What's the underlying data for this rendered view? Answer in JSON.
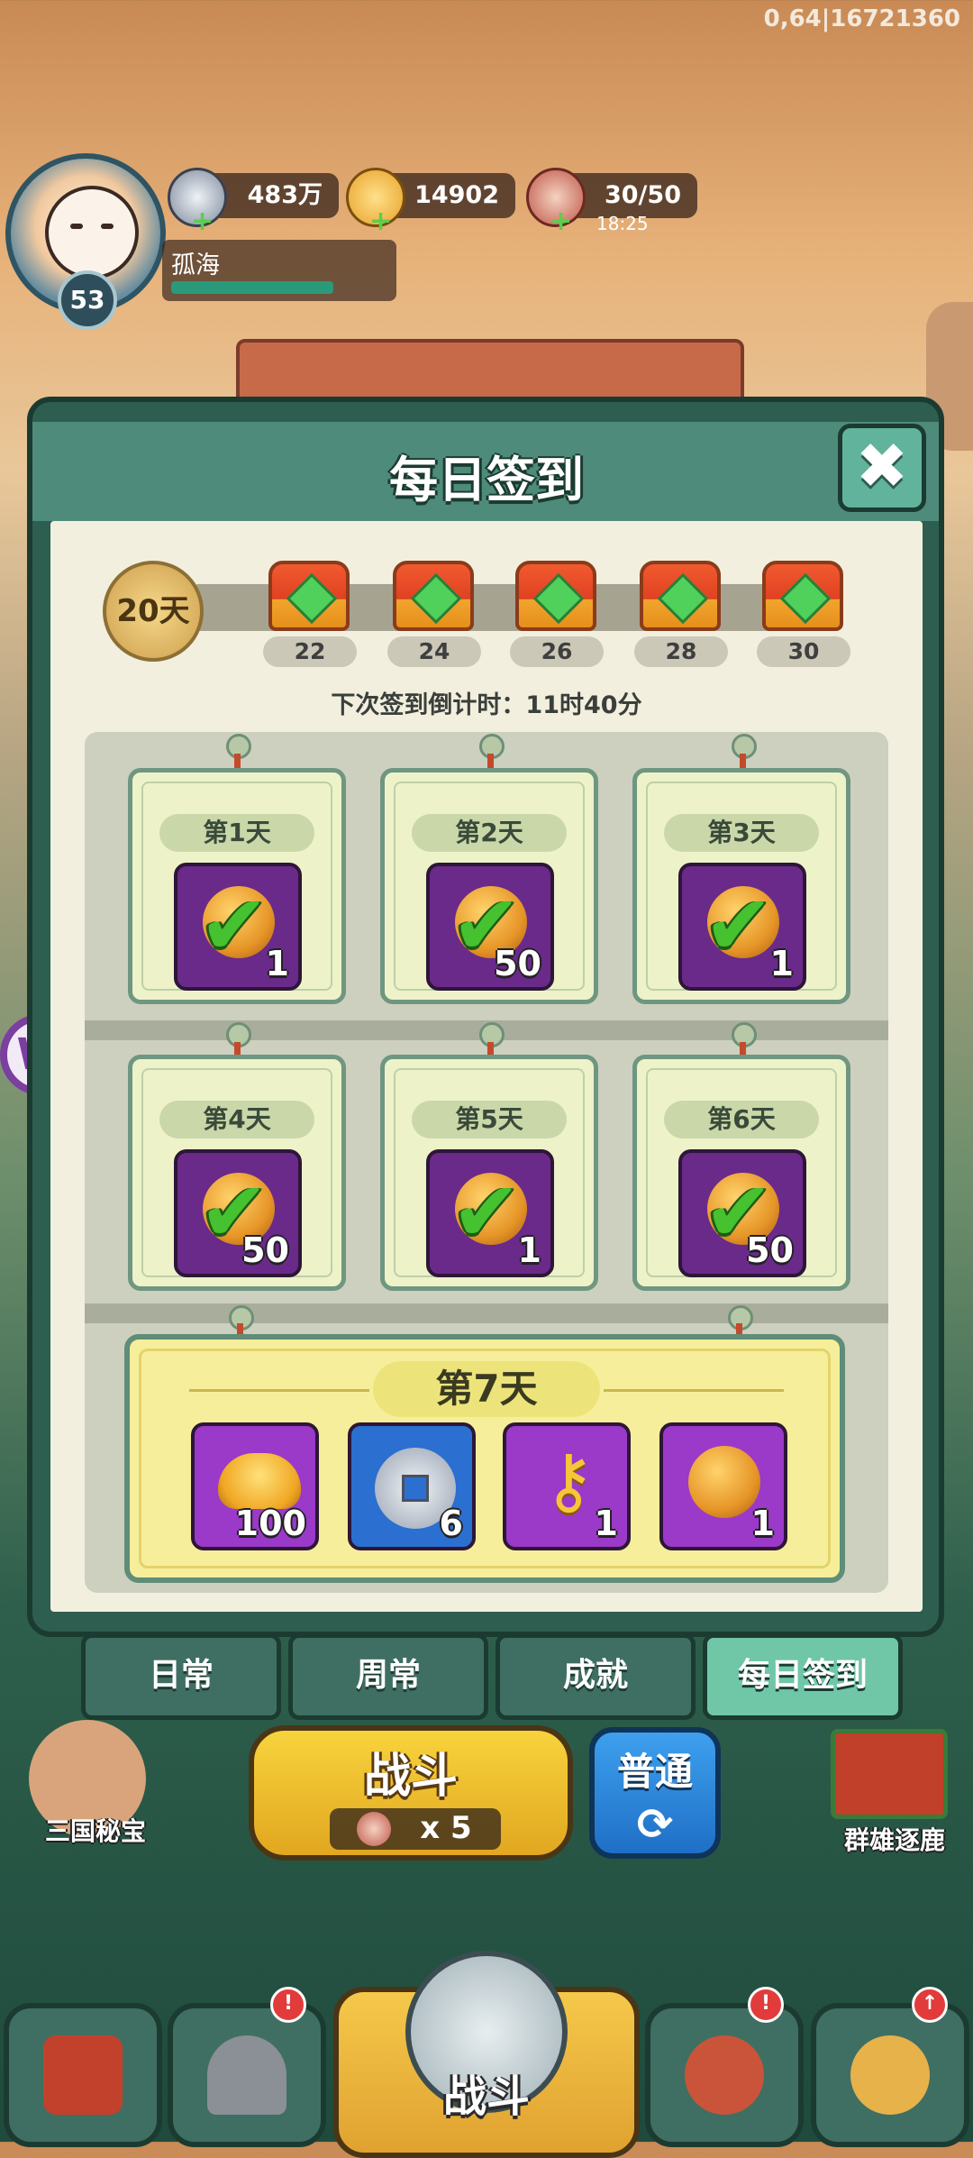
{
  "debug_text": "0,64|16721360",
  "player": {
    "name": "孤海",
    "level": "53"
  },
  "resources": {
    "silver": "483万",
    "gold": "14902",
    "stamina": "30/50",
    "stamina_timer": "18:25"
  },
  "dialog": {
    "title": "每日签到",
    "close_icon": "✖",
    "progress": {
      "days_signed": "20天",
      "milestones": [
        "22",
        "24",
        "26",
        "28",
        "30"
      ]
    },
    "countdown": "下次签到倒计时：11时40分",
    "days": [
      {
        "label": "第1天",
        "count": "1"
      },
      {
        "label": "第2天",
        "count": "50"
      },
      {
        "label": "第3天",
        "count": "1"
      },
      {
        "label": "第4天",
        "count": "50"
      },
      {
        "label": "第5天",
        "count": "1"
      },
      {
        "label": "第6天",
        "count": "50"
      }
    ],
    "day7": {
      "label": "第7天",
      "rewards": [
        {
          "icon": "gold-ingot-icon",
          "count": "100"
        },
        {
          "icon": "silver-coin-icon",
          "count": "6"
        },
        {
          "icon": "key-icon",
          "count": "1"
        },
        {
          "icon": "copper-coin-icon",
          "count": "1"
        }
      ]
    }
  },
  "tabs": [
    "日常",
    "周常",
    "成就",
    "每日签到"
  ],
  "active_tab": "每日签到",
  "battle": {
    "label": "战斗",
    "cost": "x 5",
    "mode": "普通",
    "refresh_icon": "⟳"
  },
  "side": {
    "left_label": "三国秘宝",
    "right_label": "群雄逐鹿"
  },
  "bottom_nav": {
    "center_label": "战斗",
    "badge_mark": "!"
  },
  "colors": {
    "accent_green": "#4e8b7b",
    "check_green": "#46c12f",
    "reward_purple": "#6a2a8a",
    "battle_yellow": "#f8d33d"
  }
}
